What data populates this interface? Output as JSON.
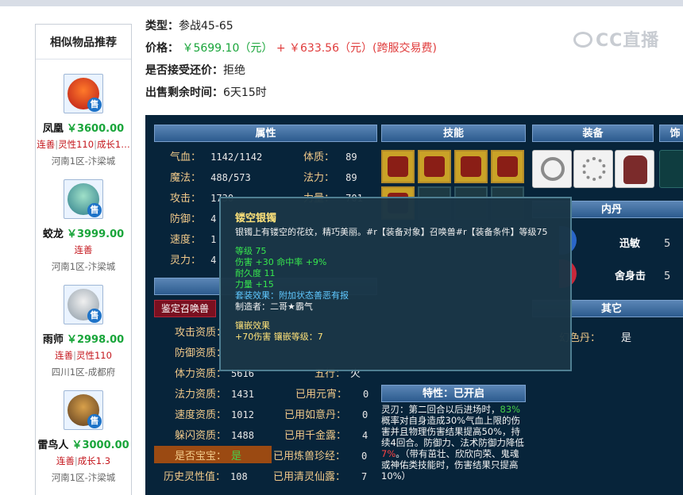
{
  "sidebar": {
    "title": "相似物品推荐",
    "items": [
      {
        "name": "凤凰",
        "price": "￥3600.00",
        "tags": [
          "连善",
          "灵性110",
          "成长1…"
        ],
        "server": "河南1区-汴梁城",
        "badge": "售",
        "icon": "phoenix-icon"
      },
      {
        "name": "蛟龙",
        "price": "￥3999.00",
        "tags": [
          "连善"
        ],
        "server": "河南1区-汴梁城",
        "badge": "售",
        "icon": "dragon-icon"
      },
      {
        "name": "雨师",
        "price": "￥2998.00",
        "tags": [
          "连善",
          "灵性110"
        ],
        "server": "四川1区-成都府",
        "badge": "售",
        "icon": "rain-master-icon"
      },
      {
        "name": "雷鸟人",
        "price": "￥3000.00",
        "tags": [
          "连善",
          "成长1.3"
        ],
        "server": "河南1区-汴梁城",
        "badge": "售",
        "icon": "thunderbird-icon"
      }
    ]
  },
  "info": {
    "type_label": "类型：",
    "type_value": "参战45-65",
    "price_label": "价格：",
    "price_main": "￥5699.10（元）",
    "price_plus": "+",
    "price_fee": "￥633.56（元）(跨服交易费)",
    "bargain_label": "是否接受还价：",
    "bargain_value": "拒绝",
    "remain_label": "出售剩余时间：",
    "remain_value": "6天15时"
  },
  "watermark": "CC直播",
  "panel": {
    "headers": {
      "attr": "属性",
      "skill": "技能",
      "equip": "装备",
      "deco": "饰",
      "neidan": "内丹",
      "other": "其它",
      "trait": "特性：已开启"
    },
    "stats_left": [
      {
        "label": "气血：",
        "value": "1142/1142"
      },
      {
        "label": "魔法：",
        "value": "488/573"
      },
      {
        "label": "攻击：",
        "value": "1730"
      },
      {
        "label": "防御：",
        "value": "4"
      },
      {
        "label": "速度：",
        "value": "1"
      },
      {
        "label": "灵力：",
        "value": "4"
      }
    ],
    "stats_right": [
      {
        "label": "体质：",
        "value": "89"
      },
      {
        "label": "法力：",
        "value": "89"
      },
      {
        "label": "力量：",
        "value": "701"
      }
    ],
    "identify_button": "鉴定召唤兽",
    "apt_left": [
      {
        "label": "攻击资质：",
        "value": ""
      },
      {
        "label": "防御资质：",
        "value": ""
      },
      {
        "label": "体力资质：",
        "value": "5616"
      },
      {
        "label": "法力资质：",
        "value": "1431"
      },
      {
        "label": "速度资质：",
        "value": "1012"
      },
      {
        "label": "躲闪资质：",
        "value": "1488"
      },
      {
        "label": "是否宝宝：",
        "value": "是"
      },
      {
        "label": "历史灵性值：",
        "value": "108"
      }
    ],
    "apt_right": [
      {
        "label": "五行：",
        "value": "火"
      },
      {
        "label": "已用元宵：",
        "value": "0"
      },
      {
        "label": "已用如意丹：",
        "value": "0"
      },
      {
        "label": "已用千金露：",
        "value": "4"
      },
      {
        "label": "已用炼兽珍经：",
        "value": "0"
      },
      {
        "label": "已用清灵仙露：",
        "value": "7"
      }
    ],
    "neidan": [
      {
        "name": "迅敏",
        "level": "5"
      },
      {
        "name": "舍身击",
        "level": "5"
      }
    ],
    "other": {
      "label": "幻色丹：",
      "value": "是"
    },
    "trait": {
      "p1": "灵刃：第二回合以后进场时，",
      "p1_hl": "83%",
      "p2": "概率对自身造成30%气血上限的伤害并且物理伤害结果提高50%，持续4回合。防御力、法术防御力降低",
      "p2_red": "7%",
      "p3": "。（带有茁壮、欣欣向荣、鬼魂或神佑类技能时，伤害结果只提高10%）"
    }
  },
  "tooltip": {
    "title": "镂空银镯",
    "desc": "银镯上有镂空的花纹，精巧美丽。#r【装备对象】召唤兽#r【装备条件】等级75",
    "level": "等级 75",
    "damage": "伤害 +30 命中率 +9%",
    "durability": "耐久度 11",
    "strength": "力量 +15",
    "set_effect": "套装效果：附加状态善恶有报",
    "maker": "制造者：二哥★霸气",
    "inlay_title": "镶嵌效果",
    "inlay": "+70伤害 镶嵌等级：7"
  }
}
